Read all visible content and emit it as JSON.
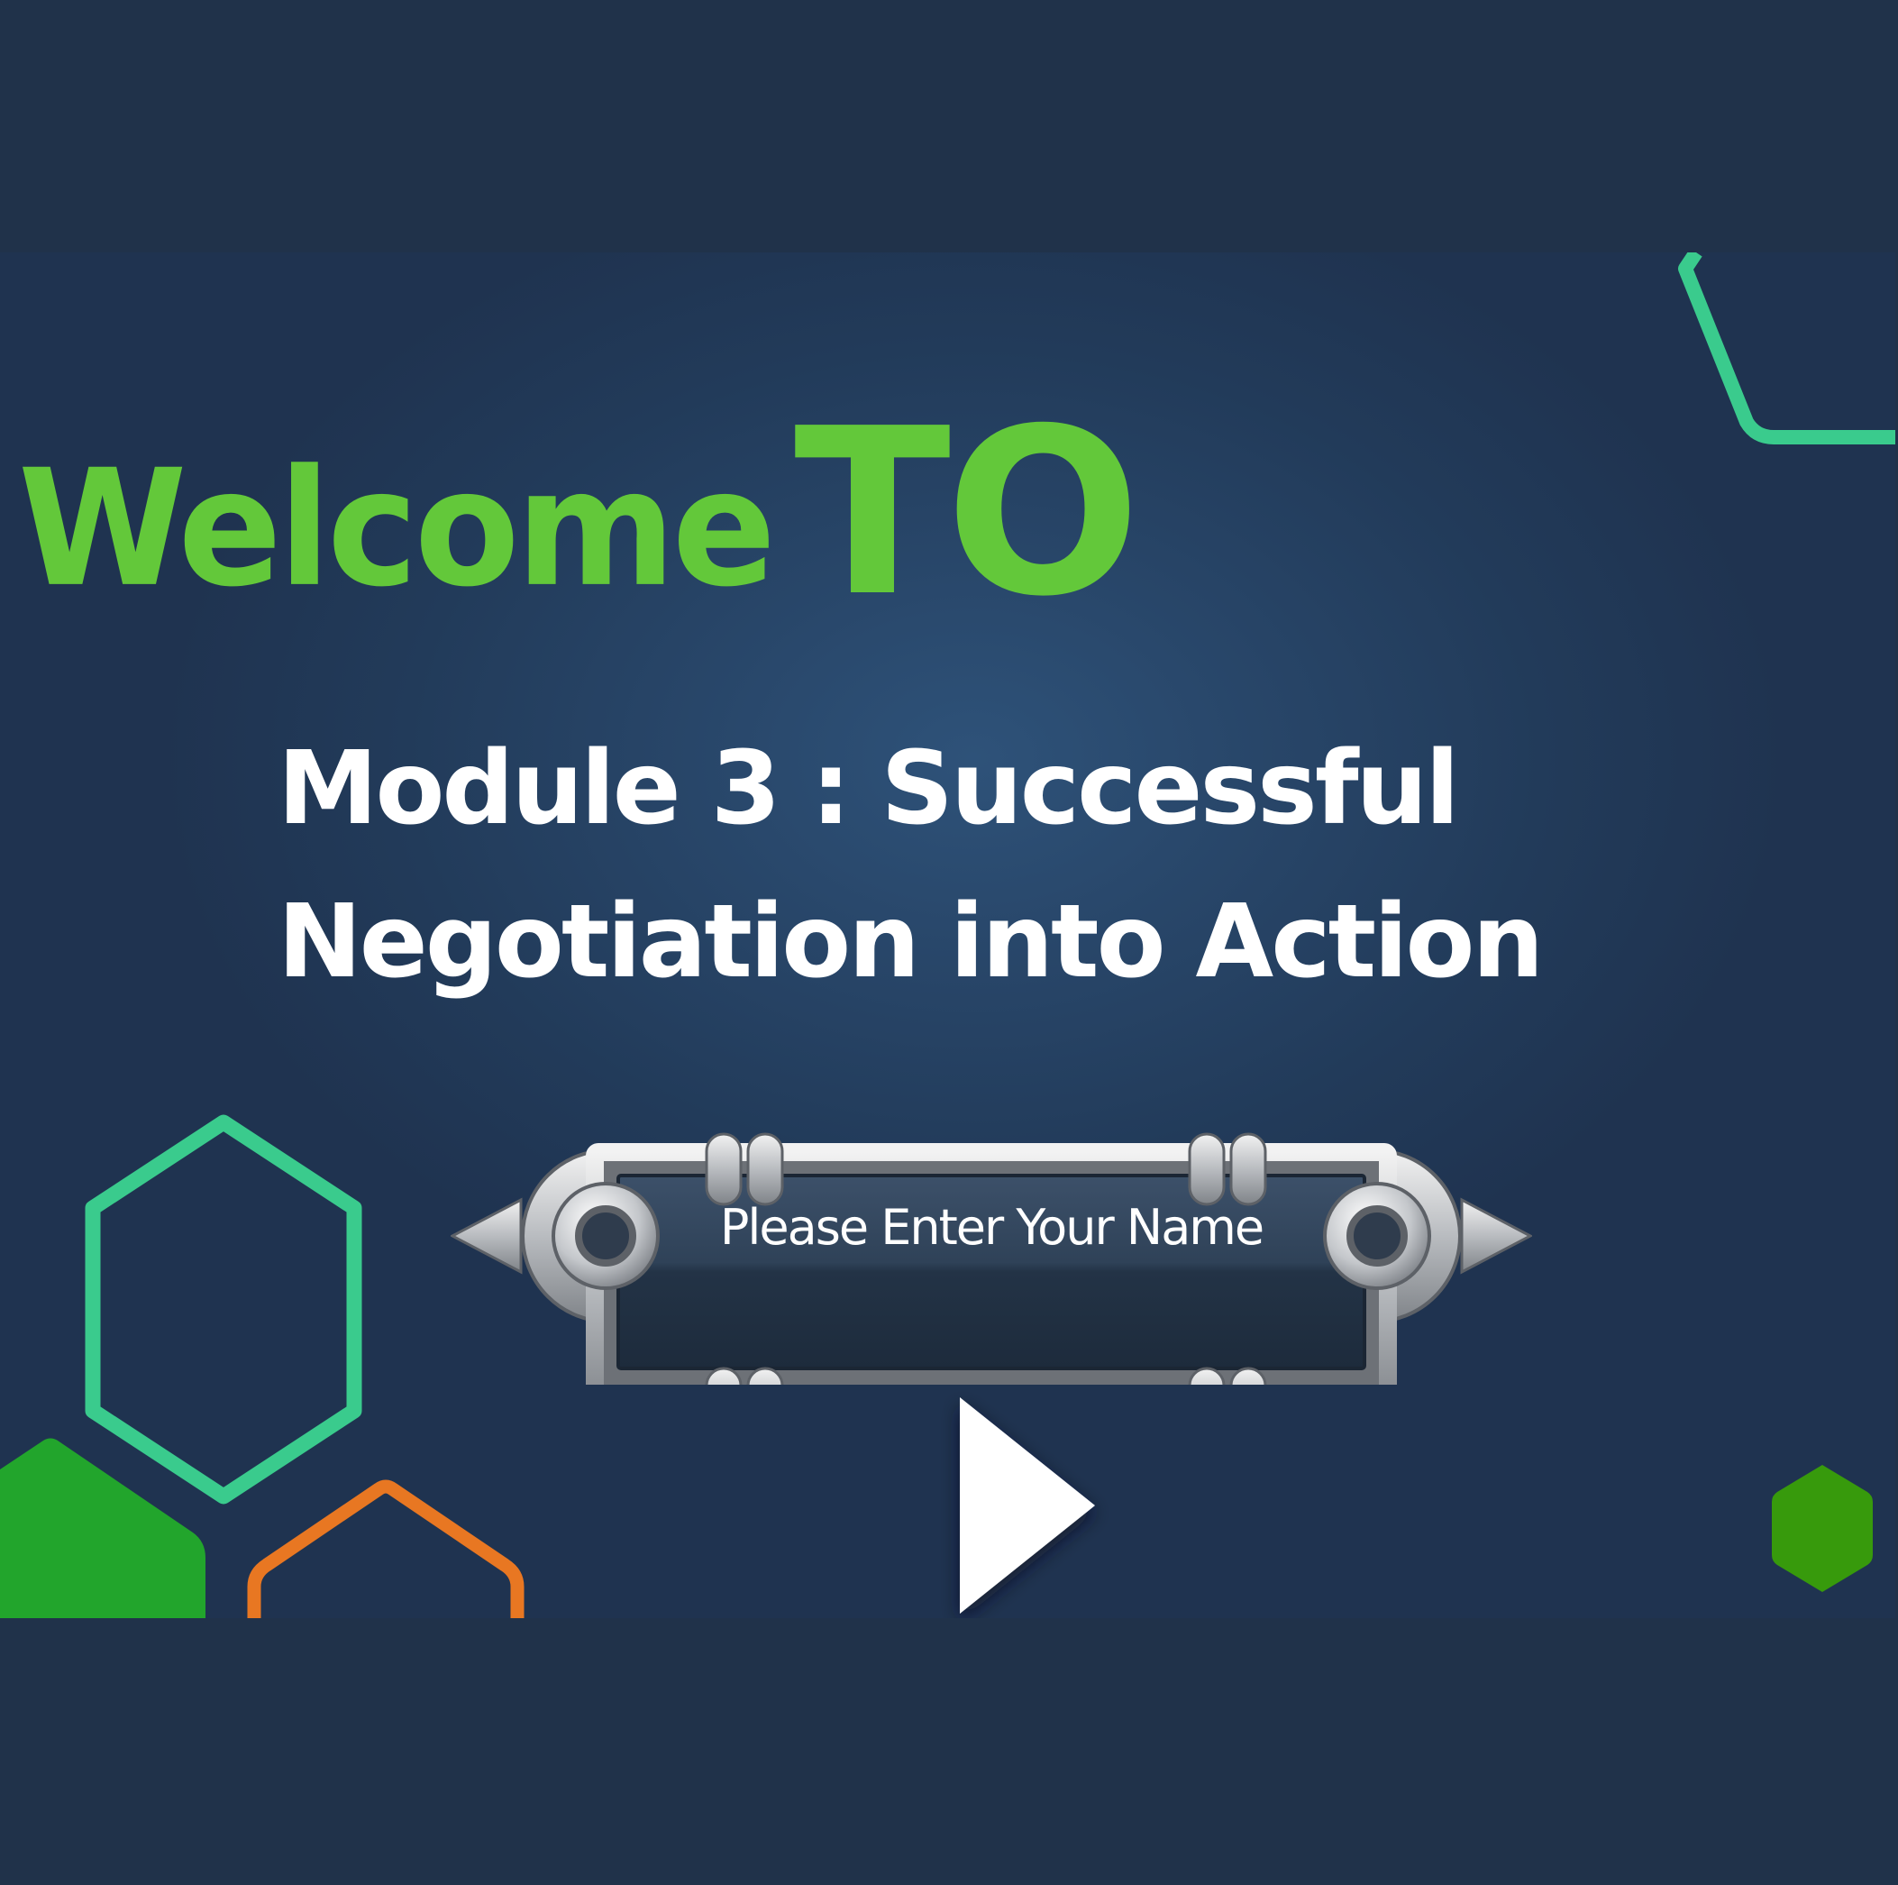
{
  "heading": {
    "welcome_word": "Welcome",
    "to_word": "TO"
  },
  "module": {
    "title": "Module 3 : Successful Negotiation into Action"
  },
  "name_entry": {
    "placeholder": "Please Enter Your Name",
    "value": ""
  },
  "colors": {
    "background": "#20324a",
    "slide_center": "#2e5279",
    "welcome_green": "#63c83a",
    "title_white": "#ffffff",
    "hex_teal": "#3acb8d",
    "hex_orange": "#e87722",
    "hex_green_fill": "#22a52c",
    "hex_dark_green_fill": "#379a0c"
  },
  "icons": {
    "play": "play-triangle-icon",
    "hexagons": "hexagon-outline-icon"
  }
}
